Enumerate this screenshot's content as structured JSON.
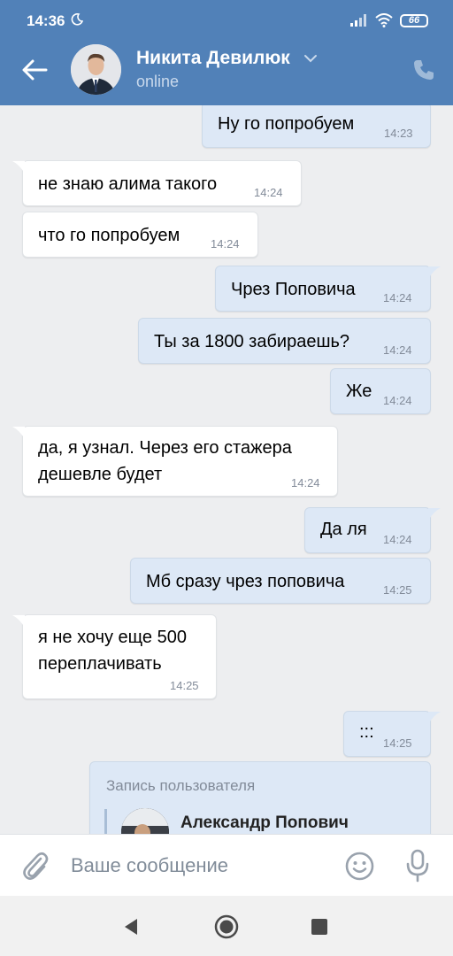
{
  "status_bar": {
    "time": "14:36",
    "battery": "66"
  },
  "header": {
    "name": "Никита Девилюк",
    "status": "online"
  },
  "messages": [
    {
      "dir": "out",
      "text": "Ну го попробуем",
      "time": "14:23"
    },
    {
      "dir": "in",
      "text": "не знаю алима такого",
      "time": "14:24"
    },
    {
      "dir": "in",
      "text": "что го попробуем",
      "time": "14:24"
    },
    {
      "dir": "out",
      "text": "Чрез Поповича",
      "time": "14:24"
    },
    {
      "dir": "out",
      "text": "Ты за 1800 забираешь?",
      "time": "14:24"
    },
    {
      "dir": "out",
      "text": "Же",
      "time": "14:24"
    },
    {
      "dir": "in",
      "line1": "да, я узнал. Через его стажера",
      "line2": "дешевле будет",
      "time": "14:24"
    },
    {
      "dir": "out",
      "text": "Да ля",
      "time": "14:24"
    },
    {
      "dir": "out",
      "text": "Мб сразу чрез поповича",
      "time": "14:25"
    },
    {
      "dir": "in",
      "line1": "я не хочу еще 500",
      "line2": "переплачивать",
      "time": "14:25"
    },
    {
      "dir": "out",
      "text": ":::",
      "time": "14:25"
    }
  ],
  "repost": {
    "label": "Запись пользователя",
    "author": "Александр Попович"
  },
  "composer": {
    "placeholder": "Ваше сообщение"
  },
  "icons": {
    "back": "arrow-left-icon",
    "call": "phone-icon",
    "attach": "paperclip-icon",
    "emoji": "smiley-icon",
    "mic": "microphone-icon",
    "moon": "moon-icon",
    "signal": "signal-icon",
    "wifi": "wifi-icon"
  },
  "colors": {
    "header": "#5181b8",
    "bubble_out": "#dde8f6",
    "bubble_in": "#ffffff",
    "background": "#edeef0"
  }
}
